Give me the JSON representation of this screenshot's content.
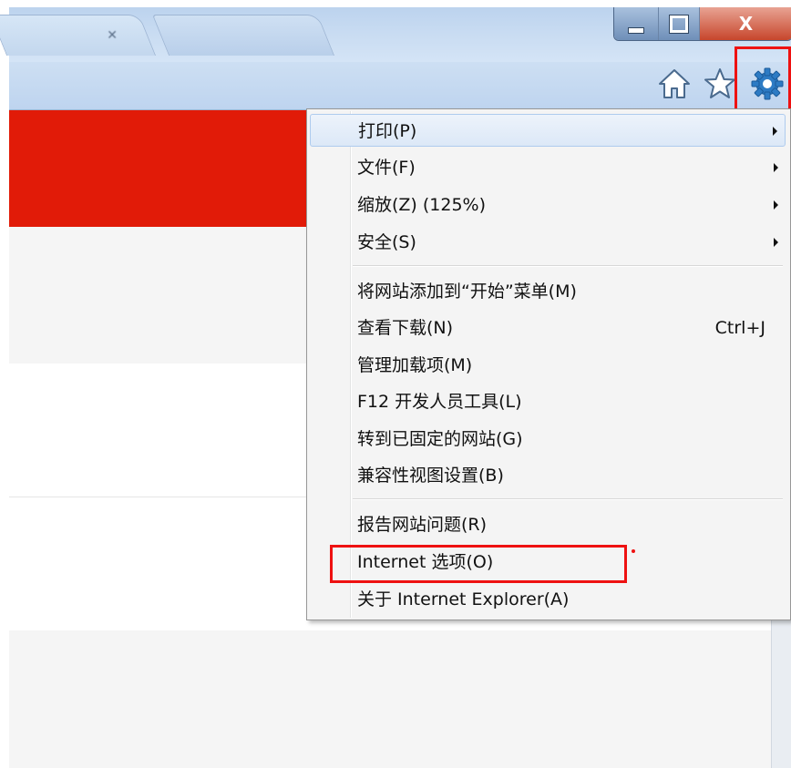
{
  "browser": {
    "window_buttons": {
      "minimize": "",
      "maximize": "",
      "close": "X"
    },
    "tabs": [
      {
        "title": ""
      },
      {
        "title": ""
      }
    ],
    "toolbar_icons": [
      "home-icon",
      "star-icon",
      "gear-icon"
    ]
  },
  "menu": {
    "items": [
      {
        "label": "打印(P)",
        "submenu": true
      },
      {
        "label": "文件(F)",
        "submenu": true
      },
      {
        "label": "缩放(Z) (125%)",
        "submenu": true
      },
      {
        "label": "安全(S)",
        "submenu": true
      },
      {
        "label": "将网站添加到“开始”菜单(M)"
      },
      {
        "label": "查看下载(N)",
        "shortcut": "Ctrl+J"
      },
      {
        "label": "管理加载项(M)"
      },
      {
        "label": "F12 开发人员工具(L)"
      },
      {
        "label": "转到已固定的网站(G)"
      },
      {
        "label": "兼容性视图设置(B)"
      },
      {
        "label": "报告网站问题(R)"
      },
      {
        "label": "Internet 选项(O)"
      },
      {
        "label": "关于 Internet Explorer(A)"
      }
    ]
  },
  "colors": {
    "annotation": "#ee1111",
    "page_banner": "#e11b08",
    "gear_icon": "#2d7bc4"
  }
}
